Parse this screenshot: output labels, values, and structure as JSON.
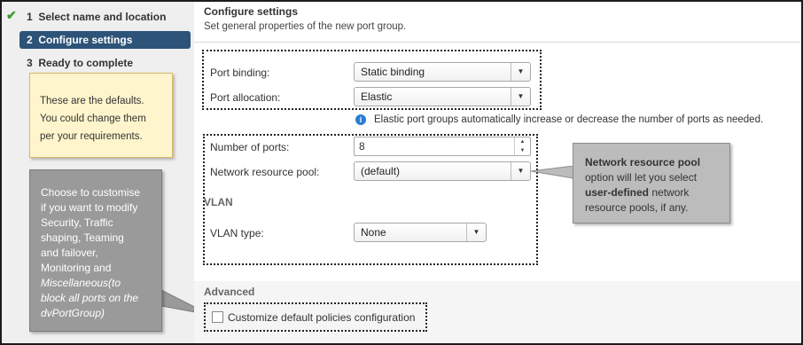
{
  "wizard": {
    "steps": [
      {
        "number": "1",
        "label": "Select name and location",
        "completed": true
      },
      {
        "number": "2",
        "label": "Configure settings",
        "active": true
      },
      {
        "number": "3",
        "label": "Ready to complete"
      }
    ]
  },
  "notes": {
    "defaults": [
      "These are the defaults.",
      "You could change them",
      "per your requirements."
    ],
    "customize": {
      "lines": [
        "Choose to customise",
        "if you want to modify",
        "Security, Traffic",
        "shaping, Teaming",
        "and failover,",
        "Monitoring and"
      ],
      "italic_lines": [
        "Miscellaneous(to",
        "block all ports on the",
        "dvPortGroup)"
      ]
    },
    "resource_pool": {
      "bold1": "Network resource pool",
      "text1": "option will let you select",
      "bold2": "user-defined",
      "text2": " network",
      "text3": "resource pools, if any."
    }
  },
  "panel": {
    "title": "Configure settings",
    "subtitle": "Set general properties of the new port group.",
    "port_binding": {
      "label": "Port binding:",
      "value": "Static binding"
    },
    "port_allocation": {
      "label": "Port allocation:",
      "value": "Elastic"
    },
    "info": "Elastic port groups automatically increase or decrease the number of ports as needed.",
    "num_ports": {
      "label": "Number of ports:",
      "value": "8"
    },
    "resource_pool": {
      "label": "Network resource pool:",
      "value": "(default)"
    },
    "vlan_section": "VLAN",
    "vlan_type": {
      "label": "VLAN type:",
      "value": "None"
    },
    "advanced_section": "Advanced",
    "customize_checkbox": "Customize default policies configuration"
  },
  "icons": {
    "check": "checkmark-icon",
    "info": "info-icon",
    "dropdown": "chevron-down-icon"
  },
  "colors": {
    "active_step": "#2d5378",
    "nav_bg": "#efefef",
    "note_yellow": "#fff5cc",
    "note_gray": "#9a9a9a",
    "info_blue": "#2b7cd3"
  }
}
